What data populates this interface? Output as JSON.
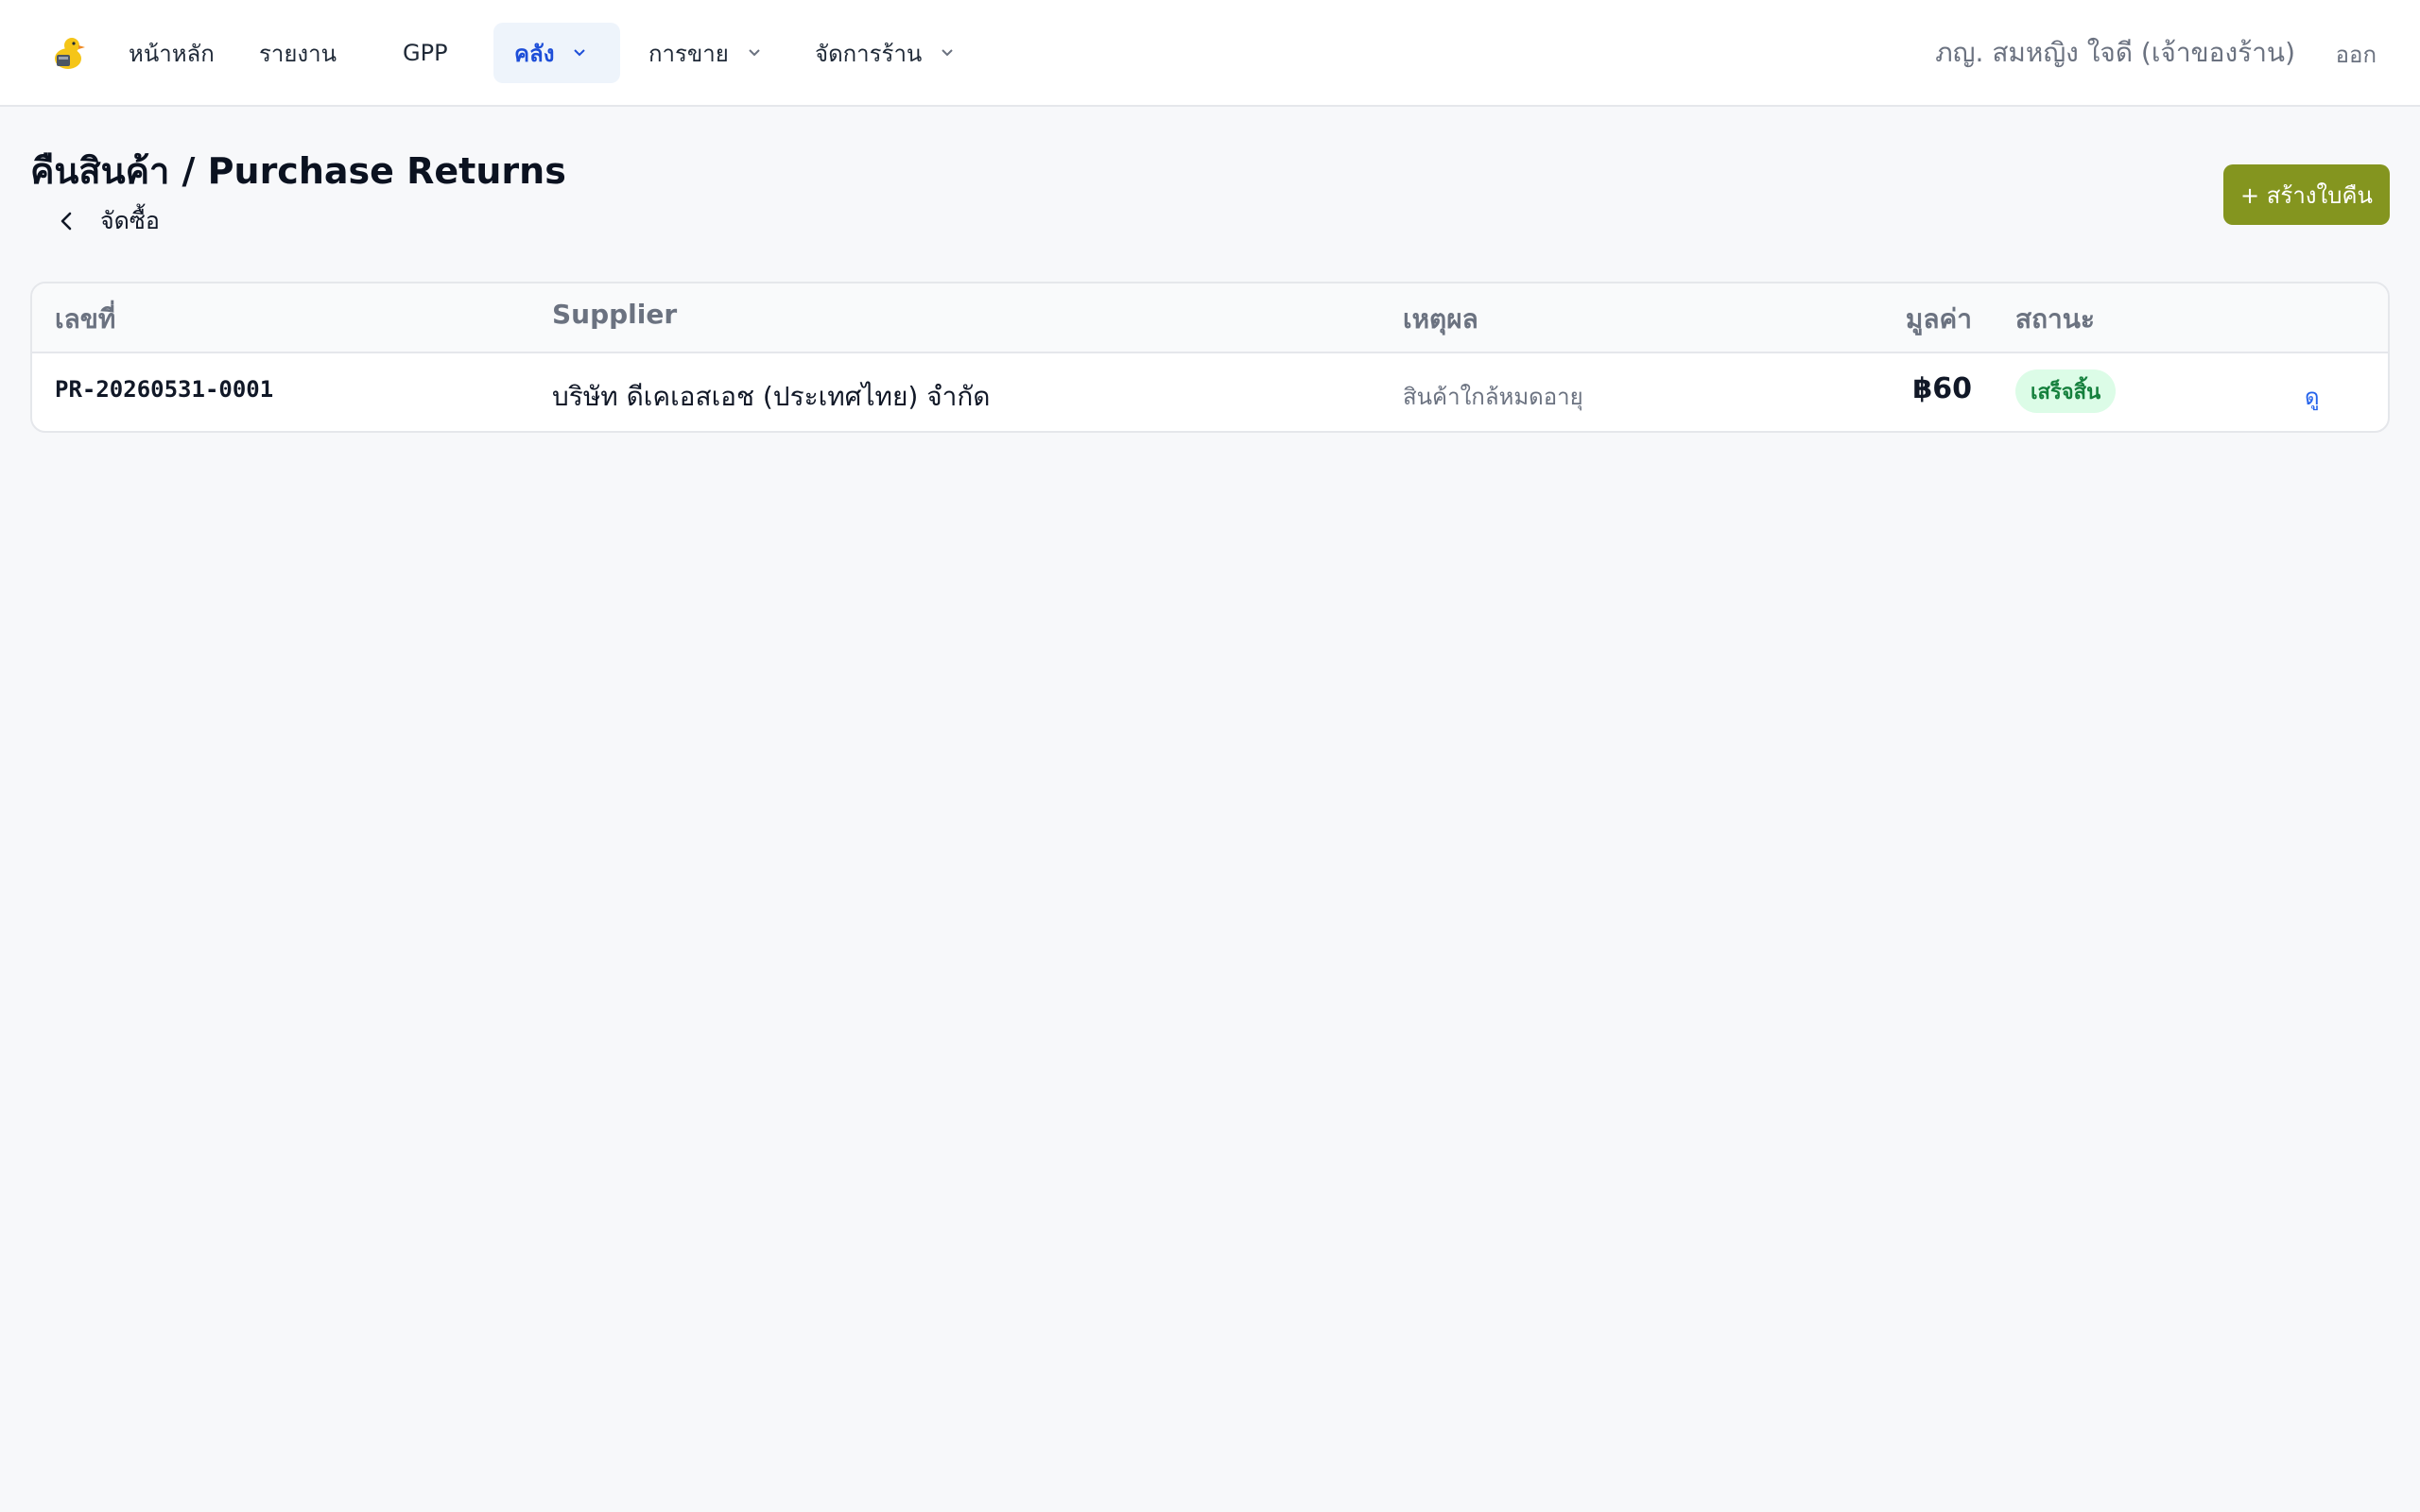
{
  "nav": {
    "logo_icon": "duck-logo-icon",
    "items": [
      {
        "label": "หน้าหลัก",
        "has_dropdown": false,
        "active": false
      },
      {
        "label": "รายงาน",
        "has_dropdown": false,
        "active": false
      },
      {
        "label": "GPP",
        "has_dropdown": false,
        "active": false
      },
      {
        "label": "คลัง",
        "has_dropdown": true,
        "active": true
      },
      {
        "label": "การขาย",
        "has_dropdown": true,
        "active": false
      },
      {
        "label": "จัดการร้าน",
        "has_dropdown": true,
        "active": false
      }
    ],
    "user_name": "ภญ. สมหญิง ใจดี (เจ้าของร้าน)",
    "logout_label": "ออก"
  },
  "page": {
    "title": "คืนสินค้า / Purchase Returns",
    "back_label": "จัดซื้อ",
    "create_button_label": "+ สร้างใบคืน"
  },
  "table": {
    "headers": [
      "เลขที่",
      "Supplier",
      "เหตุผล",
      "มูลค่า",
      "สถานะ"
    ],
    "rows": [
      {
        "number": "PR-20260531-0001",
        "supplier": "บริษัท ดีเคเอสเอช (ประเทศไทย) จำกัด",
        "reason": "สินค้าใกล้หมดอายุ",
        "amount": "฿60",
        "status": "เสร็จสิ้น",
        "action": "ดู"
      }
    ]
  },
  "colors": {
    "accent": "#84951f",
    "active_nav_text": "#1d4ed8",
    "status_success_bg": "#dcfce7",
    "status_success_text": "#15803d",
    "link": "#2563eb"
  }
}
